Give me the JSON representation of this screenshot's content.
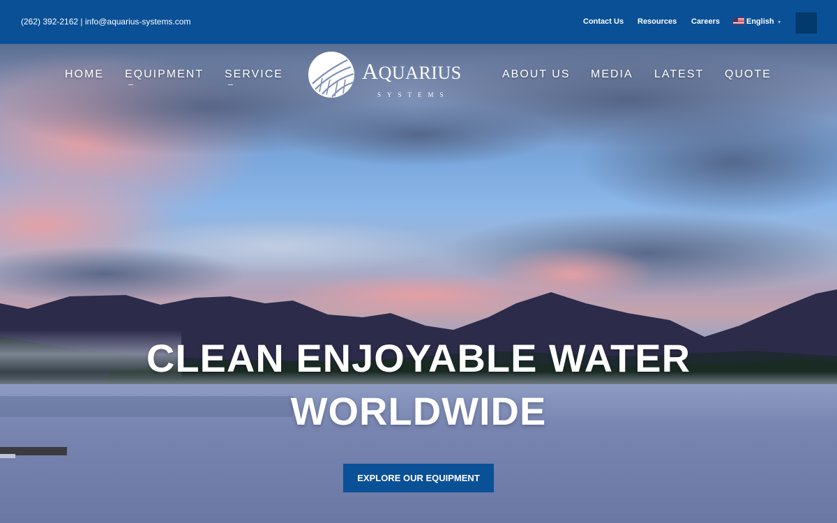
{
  "topbar": {
    "phone": "(262) 392-2162",
    "separator": "|",
    "email": "info@aquarius-systems.com",
    "links": {
      "contact": "Contact Us",
      "resources": "Resources",
      "careers": "Careers"
    },
    "language": "English",
    "caret": "▼"
  },
  "nav": {
    "home": "HOME",
    "equipment": "EQUIPMENT",
    "service": "SERVICE",
    "about": "ABOUT US",
    "media": "MEDIA",
    "latest": "LATEST",
    "quote": "QUOTE"
  },
  "logo": {
    "wordmark_first": "A",
    "wordmark_rest": "QUARIUS",
    "tagline": "SYSTEMS"
  },
  "hero": {
    "headline_line1": "CLEAN ENJOYABLE WATER",
    "headline_line2": "WORLDWIDE",
    "cta": "EXPLORE OUR EQUIPMENT"
  },
  "colors": {
    "brand_blue": "#0a5096",
    "search_box": "#033a6e"
  },
  "icons": [
    "us-flag-icon",
    "search-icon",
    "logo-sphere-icon"
  ]
}
